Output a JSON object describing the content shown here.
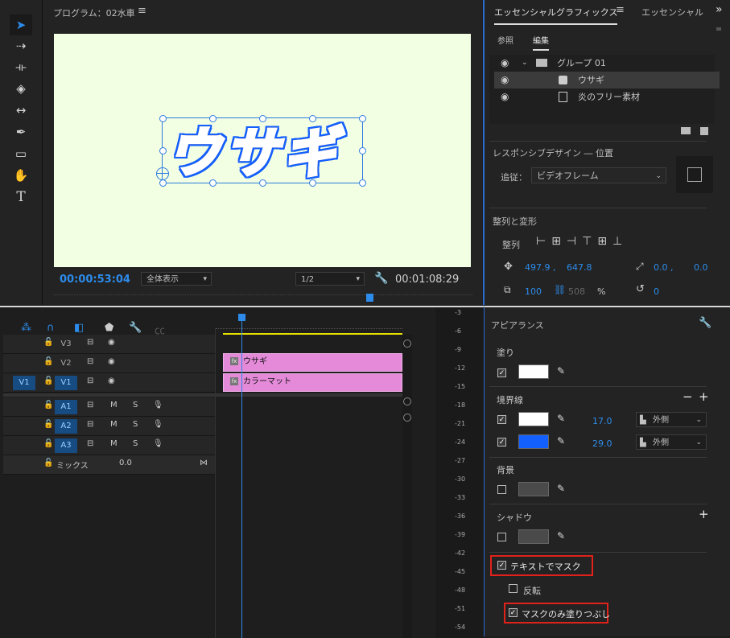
{
  "tools": [
    "selection-tool",
    "track-select-tool",
    "ripple-edit-tool",
    "razor-tool",
    "slip-tool",
    "pen-tool",
    "rectangle-tool",
    "hand-tool",
    "type-tool"
  ],
  "program": {
    "title": "プログラム：02水車",
    "menu_icon": "≡",
    "overlay_text": "ウサギ",
    "timecode_current": "00:00:53:04",
    "zoom": "全体表示",
    "resolution": "1/2",
    "timecode_duration": "00:01:08:29",
    "canvas_color": "#f2ffe2"
  },
  "eg": {
    "tab_title": "エッセンシャルグラフィックス",
    "tab2_title": "エッセンシャル",
    "subtab_browse": "参照",
    "subtab_edit": "編集",
    "layers": [
      {
        "name": "グループ 01"
      },
      {
        "name": "ウサギ"
      },
      {
        "name": "炎のフリー素材"
      }
    ],
    "responsive_title": "レスポンシブデザイン ― 位置",
    "follow_label": "追従：",
    "follow_value": "ビデオフレーム",
    "align_section": "整列と変形",
    "align_label": "整列",
    "pos_x": "497.9 ,",
    "pos_y": "647.8",
    "anchor_x": "0.0 ,",
    "anchor_y": "0.0",
    "scale": "100",
    "scale_h": "508",
    "percent": "%",
    "rotation": "0"
  },
  "timeline": {
    "tracks_video": [
      {
        "label": "V3",
        "clip": ""
      },
      {
        "label": "V2",
        "clip": "ウサギ"
      },
      {
        "label": "V1",
        "clip": "カラーマット",
        "source": "V1"
      }
    ],
    "tracks_audio": [
      {
        "label": "A1",
        "m": "M",
        "s": "S"
      },
      {
        "label": "A2",
        "m": "M",
        "s": "S"
      },
      {
        "label": "A3",
        "m": "M",
        "s": "S"
      }
    ],
    "mix_label": "ミックス",
    "mix_value": "0.0"
  },
  "meters": [
    "-3",
    "-6",
    "-9",
    "-12",
    "-15",
    "-18",
    "-21",
    "-24",
    "-27",
    "-30",
    "-33",
    "-36",
    "-39",
    "-42",
    "-45",
    "-48",
    "-51",
    "-54"
  ],
  "appearance": {
    "title": "アピアランス",
    "fill_label": "塗り",
    "stroke_label": "境界線",
    "stroke1_width": "17.0",
    "stroke1_type": "外側",
    "stroke2_width": "29.0",
    "stroke2_type": "外側",
    "background_label": "背景",
    "shadow_label": "シャドウ",
    "mask_text": "テキストでマスク",
    "invert": "反転",
    "mask_fill_only": "マスクのみ塗りつぶし",
    "colors": {
      "fill": "#ffffff",
      "stroke1": "#ffffff",
      "stroke2": "#1460ff",
      "accent": "#2d8ceb",
      "highlight": "#e0221a"
    }
  }
}
